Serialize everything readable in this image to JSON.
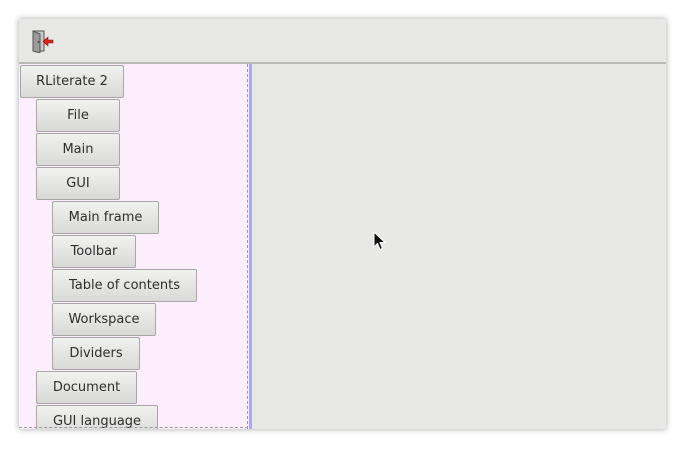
{
  "toolbar": {
    "quit_icon": "door-exit-icon"
  },
  "toc": {
    "items": [
      {
        "label": "RLiterate 2",
        "level": 0
      },
      {
        "label": "File",
        "level": 1
      },
      {
        "label": "Main",
        "level": 1
      },
      {
        "label": "GUI",
        "level": 1
      },
      {
        "label": "Main frame",
        "level": 2
      },
      {
        "label": "Toolbar",
        "level": 2
      },
      {
        "label": "Table of contents",
        "level": 2
      },
      {
        "label": "Workspace",
        "level": 2
      },
      {
        "label": "Dividers",
        "level": 2
      },
      {
        "label": "Document",
        "level": 1
      },
      {
        "label": "GUI language",
        "level": 1
      }
    ]
  },
  "colors": {
    "toc_background": "#fdeefe",
    "divider": "#a9a9f5",
    "window_background": "#e8e8e7",
    "quit_icon_arrow": "#d8261b"
  }
}
